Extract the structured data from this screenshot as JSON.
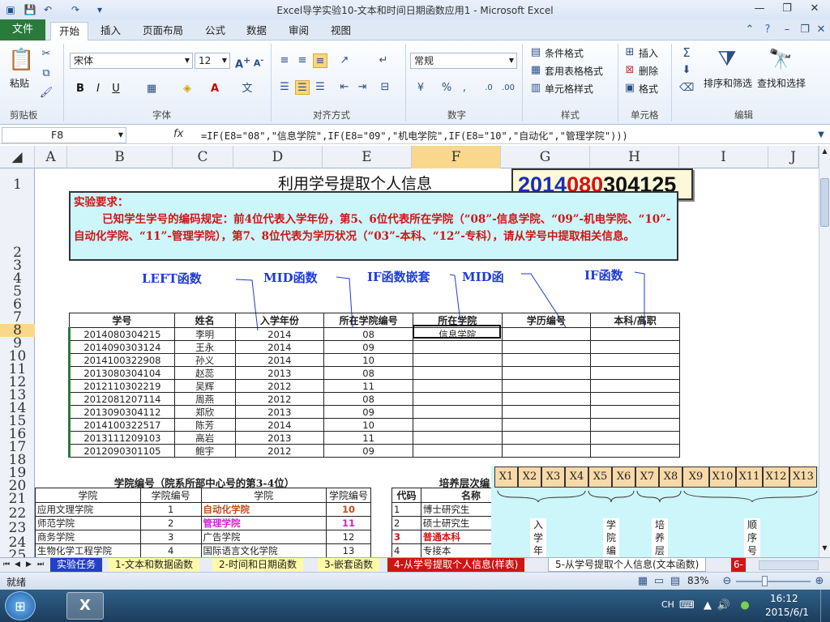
{
  "window": {
    "title": "Excel导学实验10-文本和时间日期函数应用1 - Microsoft Excel"
  },
  "tabs": {
    "file": "文件",
    "items": [
      "开始",
      "插入",
      "页面布局",
      "公式",
      "数据",
      "审阅",
      "视图"
    ]
  },
  "ribbon": {
    "paste": "粘贴",
    "font_name": "宋体",
    "font_size": "12",
    "number_format": "常规",
    "cond_format": "条件格式",
    "table_format": "套用表格格式",
    "cell_style": "单元格样式",
    "insert": "插入",
    "delete": "删除",
    "format": "格式",
    "sort_filter": "排序和筛选",
    "find_select": "查找和选择",
    "groups": [
      "剪贴板",
      "字体",
      "对齐方式",
      "数字",
      "样式",
      "单元格",
      "编辑"
    ]
  },
  "formula_bar": {
    "name_box": "F8",
    "fx": "fx",
    "formula": "=IF(E8=\"08\",\"信息学院\",IF(E8=\"09\",\"机电学院\",IF(E8=\"10\",\"自动化\",\"管理学院\")))"
  },
  "columns": [
    "A",
    "B",
    "C",
    "D",
    "E",
    "F",
    "G",
    "H",
    "I",
    "J"
  ],
  "rows": [
    "1",
    "2",
    "3",
    "4",
    "5",
    "6",
    "7",
    "8",
    "9",
    "10",
    "11",
    "12",
    "13",
    "14",
    "15",
    "16",
    "17",
    "18",
    "19",
    "20",
    "21",
    "22",
    "23",
    "24",
    "25"
  ],
  "sheet": {
    "title": "利用学号提取个人信息",
    "id_parts": [
      "2014",
      "080",
      "3",
      "04125"
    ],
    "requirement_title": "实验要求：",
    "requirement_body": "已知学生学号的编码规定：前4位代表入学年份，第5、6位代表所在学院（“08”-信息学院、“09”-机电学院、“10”-自动化学院、“11”-管理学院），第7、8位代表为学历状况（“03”-本科、“12”-专科），请从学号中提取相关信息。",
    "callouts": [
      "LEFT函数",
      "MID函数",
      "IF函数嵌套",
      "MID函",
      "IF函数"
    ],
    "main_headers": [
      "学号",
      "姓名",
      "入学年份",
      "所在学院编号",
      "所在学院",
      "学历编号",
      "本科/高职"
    ],
    "students": [
      [
        "2014080304215",
        "李明",
        "2014",
        "08",
        "信息学院",
        "",
        ""
      ],
      [
        "2014090303124",
        "王永",
        "2014",
        "09",
        "",
        "",
        ""
      ],
      [
        "2014100322908",
        "孙义",
        "2014",
        "10",
        "",
        "",
        ""
      ],
      [
        "2013080304104",
        "赵蕊",
        "2013",
        "08",
        "",
        "",
        ""
      ],
      [
        "2012110302219",
        "吴辉",
        "2012",
        "11",
        "",
        "",
        ""
      ],
      [
        "2012081207114",
        "周燕",
        "2012",
        "08",
        "",
        "",
        ""
      ],
      [
        "2013090304112",
        "郑欣",
        "2013",
        "09",
        "",
        "",
        ""
      ],
      [
        "2014100322517",
        "陈芳",
        "2014",
        "10",
        "",
        "",
        ""
      ],
      [
        "2013111209103",
        "高岩",
        "2013",
        "11",
        "",
        "",
        ""
      ],
      [
        "2012090301105",
        "鲍宇",
        "2012",
        "09",
        "",
        "",
        ""
      ]
    ],
    "college_title": "学院编号（院系所部中心号的第3-4位）",
    "college_headers": [
      "学院",
      "学院编号",
      "学院",
      "学院编号"
    ],
    "colleges": [
      [
        "应用文理学院",
        "1",
        "自动化学院",
        "10"
      ],
      [
        "师范学院",
        "2",
        "管理学院",
        "11"
      ],
      [
        "商务学院",
        "3",
        "广告学院",
        "12"
      ],
      [
        "生物化学工程学院",
        "4",
        "国际语言文化学院",
        "13"
      ]
    ],
    "level_title": "培养层次编",
    "level_headers": [
      "代码",
      "名称"
    ],
    "levels": [
      [
        "1",
        "博士研究生"
      ],
      [
        "2",
        "硕士研究生"
      ],
      [
        "3",
        "普通本科"
      ],
      [
        "4",
        "专接本"
      ]
    ],
    "diagram_cells": [
      "X1",
      "X2",
      "X3",
      "X4",
      "X5",
      "X6",
      "X7",
      "X8",
      "X9",
      "X10",
      "X11",
      "X12",
      "X13"
    ],
    "diagram_labels": [
      "入学年份",
      "学院编号",
      "培养层次",
      "顺序号"
    ]
  },
  "sheet_tabs": [
    "实验任务",
    "1-文本和数据函数",
    "2-时间和日期函数",
    "3-嵌套函数",
    "4-从学号提取个人信息(样表)",
    "5-从学号提取个人信息(文本函数)",
    "6-"
  ],
  "status": {
    "ready": "就绪",
    "zoom": "83%"
  },
  "taskbar": {
    "lang": "CH",
    "time": "16:12",
    "date": "2015/6/1"
  },
  "colors": {
    "accent_green": "#2a7a3b",
    "highlight_red": "#d01414",
    "callout_blue": "#1d3bd6"
  }
}
